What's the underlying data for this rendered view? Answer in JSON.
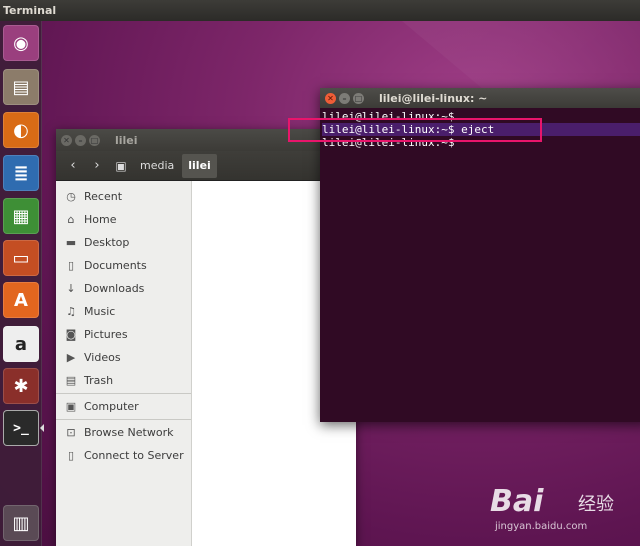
{
  "top_panel": {
    "title": "Terminal"
  },
  "launcher": {
    "items": [
      {
        "name": "dash-home",
        "glyph": "◉"
      },
      {
        "name": "files",
        "glyph": "▤"
      },
      {
        "name": "firefox",
        "glyph": "◐"
      },
      {
        "name": "libreoffice-writer",
        "glyph": "≣"
      },
      {
        "name": "libreoffice-calc",
        "glyph": "▦"
      },
      {
        "name": "libreoffice-impress",
        "glyph": "▭"
      },
      {
        "name": "ubuntu-software",
        "glyph": "A"
      },
      {
        "name": "amazon",
        "glyph": "a"
      },
      {
        "name": "system-settings",
        "glyph": "✱"
      },
      {
        "name": "terminal",
        "glyph": ">_"
      },
      {
        "name": "trash",
        "glyph": "▥"
      }
    ]
  },
  "files_window": {
    "title": "lilei",
    "breadcrumbs": [
      "media",
      "lilei"
    ],
    "sidebar": [
      {
        "label": "Recent",
        "icon": "clock-icon",
        "glyph": "◷"
      },
      {
        "label": "Home",
        "icon": "home-icon",
        "glyph": "⌂"
      },
      {
        "label": "Desktop",
        "icon": "folder-icon",
        "glyph": "▬"
      },
      {
        "label": "Documents",
        "icon": "document-icon",
        "glyph": "▯"
      },
      {
        "label": "Downloads",
        "icon": "download-icon",
        "glyph": "↓"
      },
      {
        "label": "Music",
        "icon": "music-icon",
        "glyph": "♫"
      },
      {
        "label": "Pictures",
        "icon": "camera-icon",
        "glyph": "◙"
      },
      {
        "label": "Videos",
        "icon": "video-icon",
        "glyph": "▶"
      },
      {
        "label": "Trash",
        "icon": "trash-icon",
        "glyph": "▤"
      },
      {
        "label": "Computer",
        "icon": "computer-icon",
        "glyph": "▣"
      },
      {
        "label": "Browse Network",
        "icon": "network-icon",
        "glyph": "⊡"
      },
      {
        "label": "Connect to Server",
        "icon": "server-icon",
        "glyph": "▯"
      }
    ]
  },
  "terminal_window": {
    "title": "lilei@lilei-linux: ~",
    "lines": [
      "lilei@lilei-linux:~$",
      "lilei@lilei-linux:~$ eject",
      "lilei@lilei-linux:~$"
    ]
  },
  "watermark": {
    "brand": "Bai",
    "cn": "经验",
    "url": "jingyan.baidu.com"
  }
}
